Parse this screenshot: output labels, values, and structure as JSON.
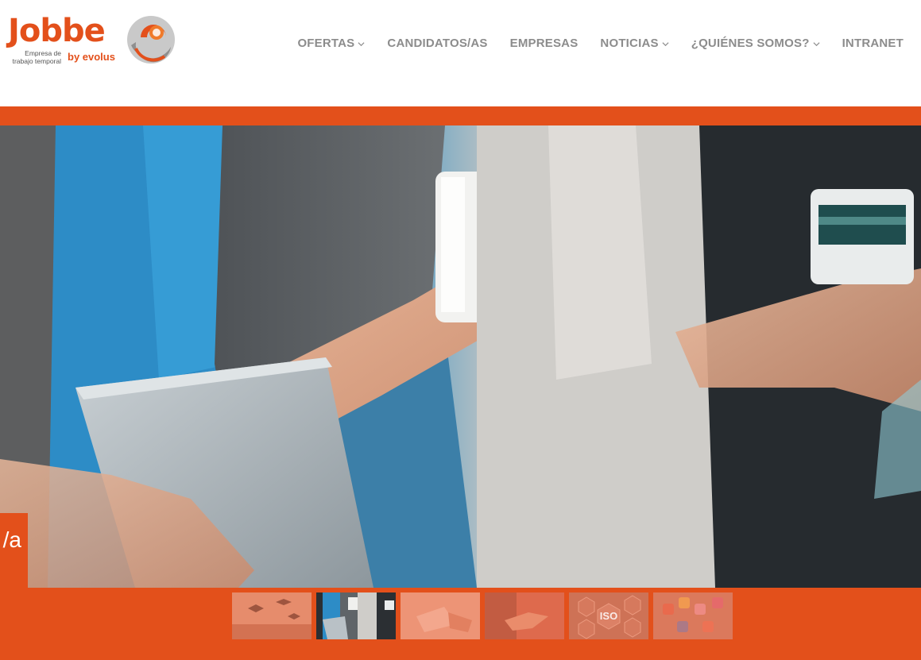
{
  "brand": {
    "name": "Jobbe",
    "tagline": "Empresa de trabajo temporal",
    "by": "by evolus",
    "accent_color": "#e3501b"
  },
  "nav": {
    "items": [
      {
        "label": "OFERTAS",
        "has_dropdown": true
      },
      {
        "label": "CANDIDATOS/AS",
        "has_dropdown": false
      },
      {
        "label": "EMPRESAS",
        "has_dropdown": false
      },
      {
        "label": "NOTICIAS",
        "has_dropdown": true
      },
      {
        "label": "¿QUIÉNES SOMOS?",
        "has_dropdown": true
      },
      {
        "label": "INTRANET",
        "has_dropdown": false
      }
    ]
  },
  "hero": {
    "image": "people-holding-laptop-and-coffee-mugs",
    "side_tab_text": "/a"
  },
  "thumbnails": {
    "active_index": 1,
    "items": [
      {
        "image": "graduates-throwing-caps",
        "caption": ""
      },
      {
        "image": "people-holding-laptop-and-coffee-mugs",
        "caption": ""
      },
      {
        "image": "hands-writing-on-paper",
        "caption": ""
      },
      {
        "image": "handshake",
        "caption": ""
      },
      {
        "image": "iso-icons-hexagons",
        "caption": "ISO"
      },
      {
        "image": "smartphone-social-apps",
        "caption": ""
      }
    ]
  }
}
